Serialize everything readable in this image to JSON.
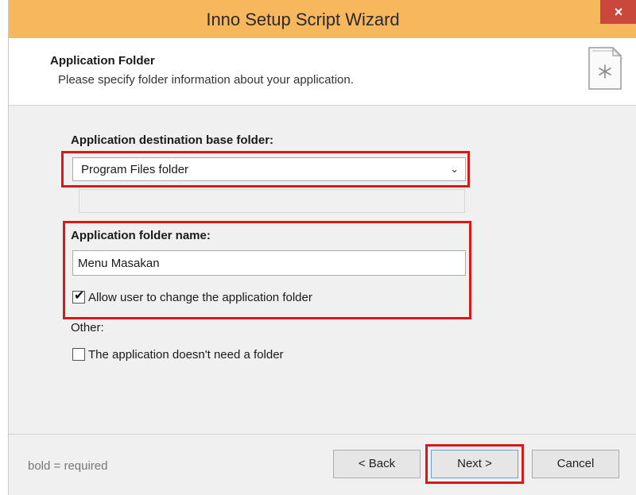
{
  "window": {
    "title": "Inno Setup Script Wizard",
    "close_label": "×"
  },
  "header": {
    "title": "Application Folder",
    "subtitle": "Please specify folder information about your application."
  },
  "form": {
    "base_folder_label": "Application destination base folder:",
    "base_folder_value": "Program Files folder",
    "folder_name_label": "Application folder name:",
    "folder_name_value": "Menu Masakan",
    "allow_change_label": "Allow user to change the application folder",
    "allow_change_checked": true,
    "other_label": "Other:",
    "no_folder_label": "The application doesn't need a folder",
    "no_folder_checked": false
  },
  "footer": {
    "hint": "bold = required",
    "back_label": "< Back",
    "next_label": "Next >",
    "cancel_label": "Cancel"
  },
  "colors": {
    "highlight": "#d61a1a",
    "titlebar": "#f7b75d",
    "close": "#c9483b"
  },
  "icons": {
    "header_icon": "document-star-icon",
    "dropdown": "chevron-down-icon",
    "check": "checkmark-icon"
  }
}
